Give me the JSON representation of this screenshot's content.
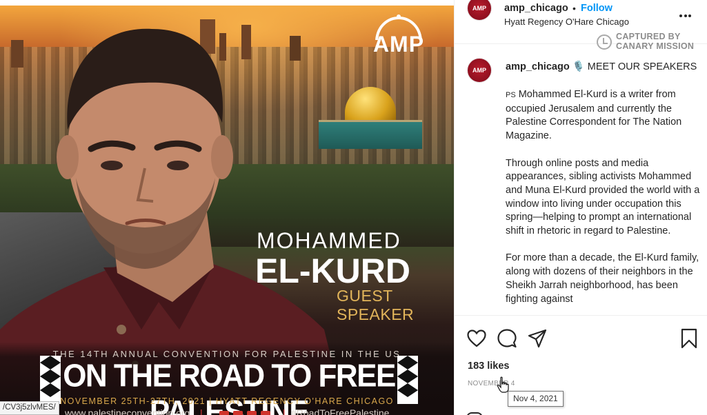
{
  "poster": {
    "logo_text": "AMP",
    "speaker_first_name": "MOHAMMED",
    "speaker_last_name": "EL-KURD",
    "speaker_role": "GUEST SPEAKER",
    "convention_line": "THE 14TH ANNUAL CONVENTION FOR PALESTINE IN THE US",
    "event_title": "ON THE ROAD TO FREE PALESTINE",
    "dates_line": "NOVEMBER 25TH-27TH, 2021 | HYATT REGENCY O'HARE CHICAGO",
    "website": "www.palestineconvention.org",
    "hashtag": "#RoadToFreePalestine",
    "social_icons": [
      "facebook-icon",
      "instagram-icon",
      "twitter-icon",
      "youtube-icon"
    ]
  },
  "status_bar": {
    "url": "/CV3j5zlvMES/"
  },
  "post": {
    "username": "amp_chicago",
    "follow_label": "Follow",
    "location": "Hyatt Regency O'Hare Chicago",
    "avatar_text": "AMP",
    "watermark_line1": "CAPTURED BY",
    "watermark_line2": "CANARY MISSION",
    "caption_heading": "🎙️ MEET OUR SPEAKERS",
    "caption_ps": "PS",
    "caption_paragraphs": [
      "Mohammed El-Kurd is a writer from occupied Jerusalem and currently the Palestine Correspondent for The Nation Magazine.",
      "Through online posts and media appearances, sibling activists Mohammed and Muna El-Kurd provided the world with a window into living under occupation this spring—helping to prompt an international shift in rhetoric in regard to Palestine.",
      "For more than a decade, the El-Kurd family, along with dozens of their neighbors in the Sheikh Jarrah neighborhood, has been fighting against"
    ],
    "likes": "183 likes",
    "date": "NOVEMBER 4",
    "date_tooltip": "Nov 4, 2021"
  },
  "colors": {
    "follow_blue": "#0095f6",
    "brand_red": "#a3121f",
    "poster_gold": "#e2b55a"
  }
}
